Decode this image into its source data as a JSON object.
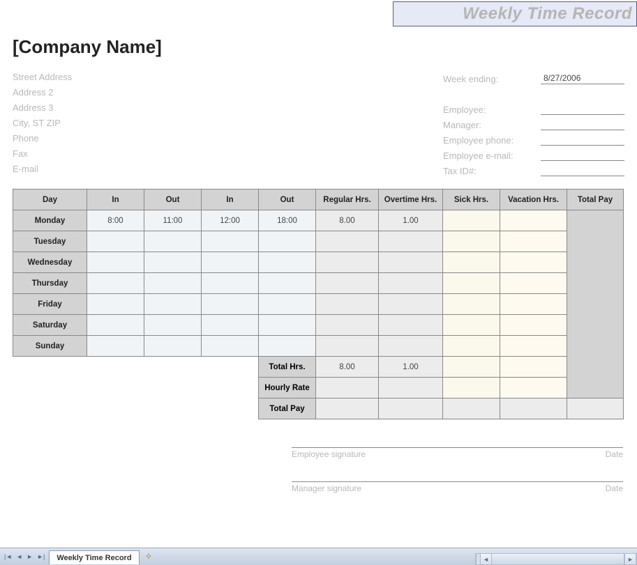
{
  "doc_title": "Weekly Time Record",
  "company": "[Company Name]",
  "address": {
    "street": "Street Address",
    "address2": "Address 2",
    "address3": "Address 3",
    "city_st_zip": "City, ST  ZIP",
    "phone": "Phone",
    "fax": "Fax",
    "email": "E-mail"
  },
  "right_fields": {
    "week_ending_label": "Week ending:",
    "week_ending_value": "8/27/2006",
    "employee_label": "Employee:",
    "employee_value": "",
    "manager_label": "Manager:",
    "manager_value": "",
    "emp_phone_label": "Employee phone:",
    "emp_phone_value": "",
    "emp_email_label": "Employee e-mail:",
    "emp_email_value": "",
    "tax_id_label": "Tax ID#:",
    "tax_id_value": ""
  },
  "headers": {
    "day": "Day",
    "in1": "In",
    "out1": "Out",
    "in2": "In",
    "out2": "Out",
    "regular": "Regular Hrs.",
    "overtime": "Overtime Hrs.",
    "sick": "Sick Hrs.",
    "vacation": "Vacation Hrs.",
    "totalpay": "Total Pay"
  },
  "days": [
    {
      "name": "Monday",
      "in1": "8:00",
      "out1": "11:00",
      "in2": "12:00",
      "out2": "18:00",
      "reg": "8.00",
      "ot": "1.00",
      "sick": "",
      "vac": ""
    },
    {
      "name": "Tuesday",
      "in1": "",
      "out1": "",
      "in2": "",
      "out2": "",
      "reg": "",
      "ot": "",
      "sick": "",
      "vac": ""
    },
    {
      "name": "Wednesday",
      "in1": "",
      "out1": "",
      "in2": "",
      "out2": "",
      "reg": "",
      "ot": "",
      "sick": "",
      "vac": ""
    },
    {
      "name": "Thursday",
      "in1": "",
      "out1": "",
      "in2": "",
      "out2": "",
      "reg": "",
      "ot": "",
      "sick": "",
      "vac": ""
    },
    {
      "name": "Friday",
      "in1": "",
      "out1": "",
      "in2": "",
      "out2": "",
      "reg": "",
      "ot": "",
      "sick": "",
      "vac": ""
    },
    {
      "name": "Saturday",
      "in1": "",
      "out1": "",
      "in2": "",
      "out2": "",
      "reg": "",
      "ot": "",
      "sick": "",
      "vac": ""
    },
    {
      "name": "Sunday",
      "in1": "",
      "out1": "",
      "in2": "",
      "out2": "",
      "reg": "",
      "ot": "",
      "sick": "",
      "vac": ""
    }
  ],
  "summary": {
    "total_hrs_label": "Total Hrs.",
    "total_reg": "8.00",
    "total_ot": "1.00",
    "total_sick": "",
    "total_vac": "",
    "hourly_rate_label": "Hourly Rate",
    "rate_reg": "",
    "rate_ot": "",
    "rate_sick": "",
    "rate_vac": "",
    "total_pay_label": "Total Pay",
    "pay_reg": "",
    "pay_ot": "",
    "pay_sick": "",
    "pay_vac": "",
    "grand_total": ""
  },
  "signatures": {
    "emp_sig": "Employee signature",
    "mgr_sig": "Manager signature",
    "date": "Date"
  },
  "tab_name": "Weekly Time Record"
}
